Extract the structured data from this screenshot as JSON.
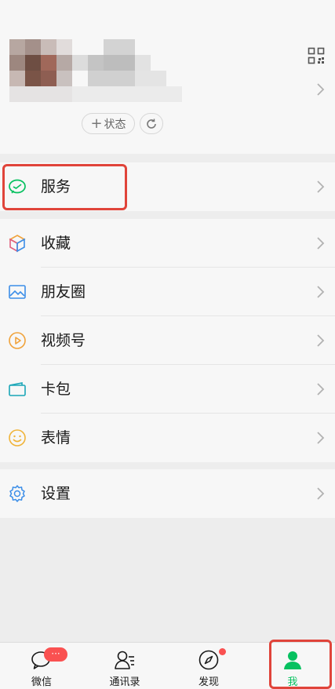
{
  "profile": {
    "status_label": "状态",
    "status_plus": "+",
    "qr_icon": "qr-code-icon",
    "refresh_icon": "refresh-icon"
  },
  "menu": {
    "service": {
      "label": "服务",
      "icon": "service-wallet-icon",
      "color": "#07c160"
    },
    "items": [
      {
        "label": "收藏",
        "icon": "favorites-cube-icon"
      },
      {
        "label": "朋友圈",
        "icon": "moments-image-icon"
      },
      {
        "label": "视频号",
        "icon": "channels-play-icon"
      },
      {
        "label": "卡包",
        "icon": "card-wallet-icon"
      },
      {
        "label": "表情",
        "icon": "sticker-smile-icon"
      }
    ],
    "settings": {
      "label": "设置",
      "icon": "settings-gear-icon"
    }
  },
  "tabbar": {
    "tabs": [
      {
        "label": "微信",
        "icon": "chats-icon",
        "badge": "···"
      },
      {
        "label": "通讯录",
        "icon": "contacts-icon"
      },
      {
        "label": "发现",
        "icon": "discover-compass-icon",
        "dot": true
      },
      {
        "label": "我",
        "icon": "me-person-icon",
        "active": true
      }
    ],
    "active_color": "#07c160",
    "badge_color": "#fa5151"
  },
  "annotation_color": "#e0443a"
}
